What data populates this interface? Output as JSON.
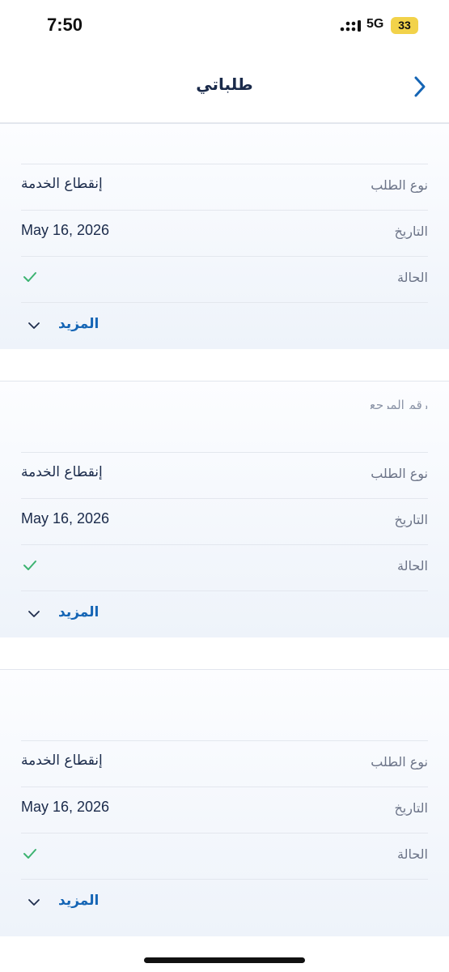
{
  "status": {
    "time": "7:50",
    "network": "5G",
    "battery": "33"
  },
  "nav": {
    "title": "طلباتي"
  },
  "cards": [
    {
      "ref_label": "",
      "request_type_label": "نوع الطلب",
      "request_type": "إنقطاع الخدمة",
      "date_label": "التاريخ",
      "date": "May 16, 2026",
      "status_label": "الحالة",
      "more_label": "المزيد"
    },
    {
      "ref_label": "رقم المرجع",
      "request_type_label": "نوع الطلب",
      "request_type": "إنقطاع الخدمة",
      "date_label": "التاريخ",
      "date": "May 16, 2026",
      "status_label": "الحالة",
      "more_label": "المزيد"
    },
    {
      "ref_label": "",
      "request_type_label": "نوع الطلب",
      "request_type": "إنقطاع الخدمة",
      "date_label": "التاريخ",
      "date": "May 16, 2026",
      "status_label": "الحالة",
      "more_label": "المزيد"
    }
  ],
  "colors": {
    "accent": "#1565b5",
    "success": "#3cb371",
    "battery": "#f2d24a"
  }
}
